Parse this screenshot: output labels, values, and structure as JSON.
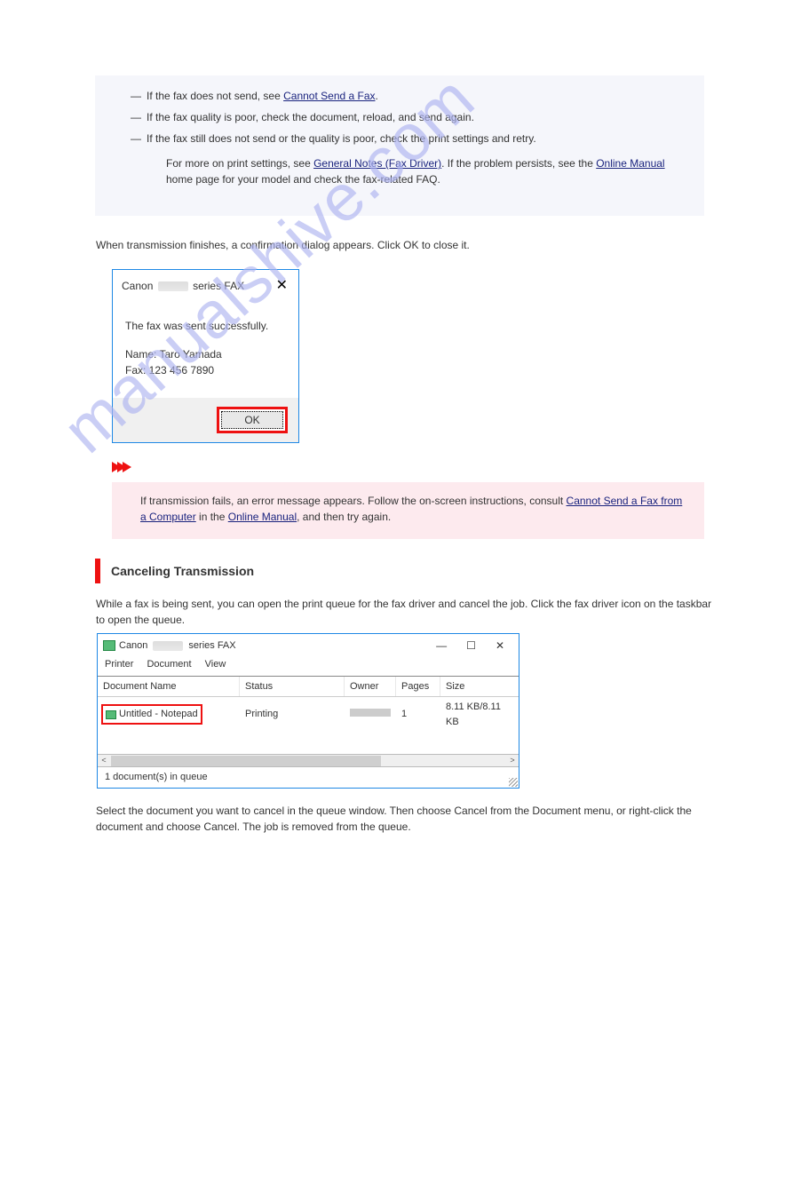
{
  "bluebox": {
    "items": [
      {
        "prefix": "If the fax does not send, see ",
        "link": "Cannot Send a Fax",
        "suffix": "."
      },
      {
        "prefix": "If the fax quality is poor, check the document, reload, and send again.",
        "link": "",
        "suffix": ""
      },
      {
        "prefix": "If the fax still does not send or the quality is poor, check the print settings and retry.",
        "link": "",
        "suffix": ""
      }
    ],
    "para_before": "For more on print settings, see ",
    "para_link": "General Notes (Fax Driver)",
    "para_after_1": ". If the problem persists, see the ",
    "para_link2": "Online Manual",
    "para_after_2": " home page for your model and check the fax-related FAQ."
  },
  "after_blue": "When transmission finishes, a confirmation dialog appears. Click OK to close it.",
  "dialog": {
    "title_prefix": "Canon",
    "title_suffix": "series FAX",
    "line1": "The fax was sent successfully.",
    "line2": "Name: Taro Yamada",
    "line3": "Fax: 123 456 7890",
    "ok": "OK"
  },
  "pink": {
    "text_before": "If transmission fails, an error message appears. Follow the on-screen instructions, consult ",
    "link1": "Cannot Send a Fax from a Computer",
    "text_mid": " in the ",
    "link2": "Online Manual",
    "text_after": ", and then try again."
  },
  "heading": "Canceling Transmission",
  "cancel_para": "While a fax is being sent, you can open the print queue for the fax driver and cancel the job. Click the fax driver icon on the taskbar to open the queue.",
  "queue": {
    "title_prefix": "Canon",
    "title_suffix": "series FAX",
    "menu": [
      "Printer",
      "Document",
      "View"
    ],
    "cols": {
      "name": "Document Name",
      "status": "Status",
      "owner": "Owner",
      "pages": "Pages",
      "size": "Size"
    },
    "row": {
      "name": "Untitled - Notepad",
      "status": "Printing",
      "pages": "1",
      "size": "8.11 KB/8.11 KB"
    },
    "footer": "1 document(s) in queue"
  },
  "after_queue": "Select the document you want to cancel in the queue window. Then choose Cancel from the Document menu, or right-click the document and choose Cancel. The job is removed from the queue.",
  "watermark": "manualshive.com",
  "page_num": ""
}
